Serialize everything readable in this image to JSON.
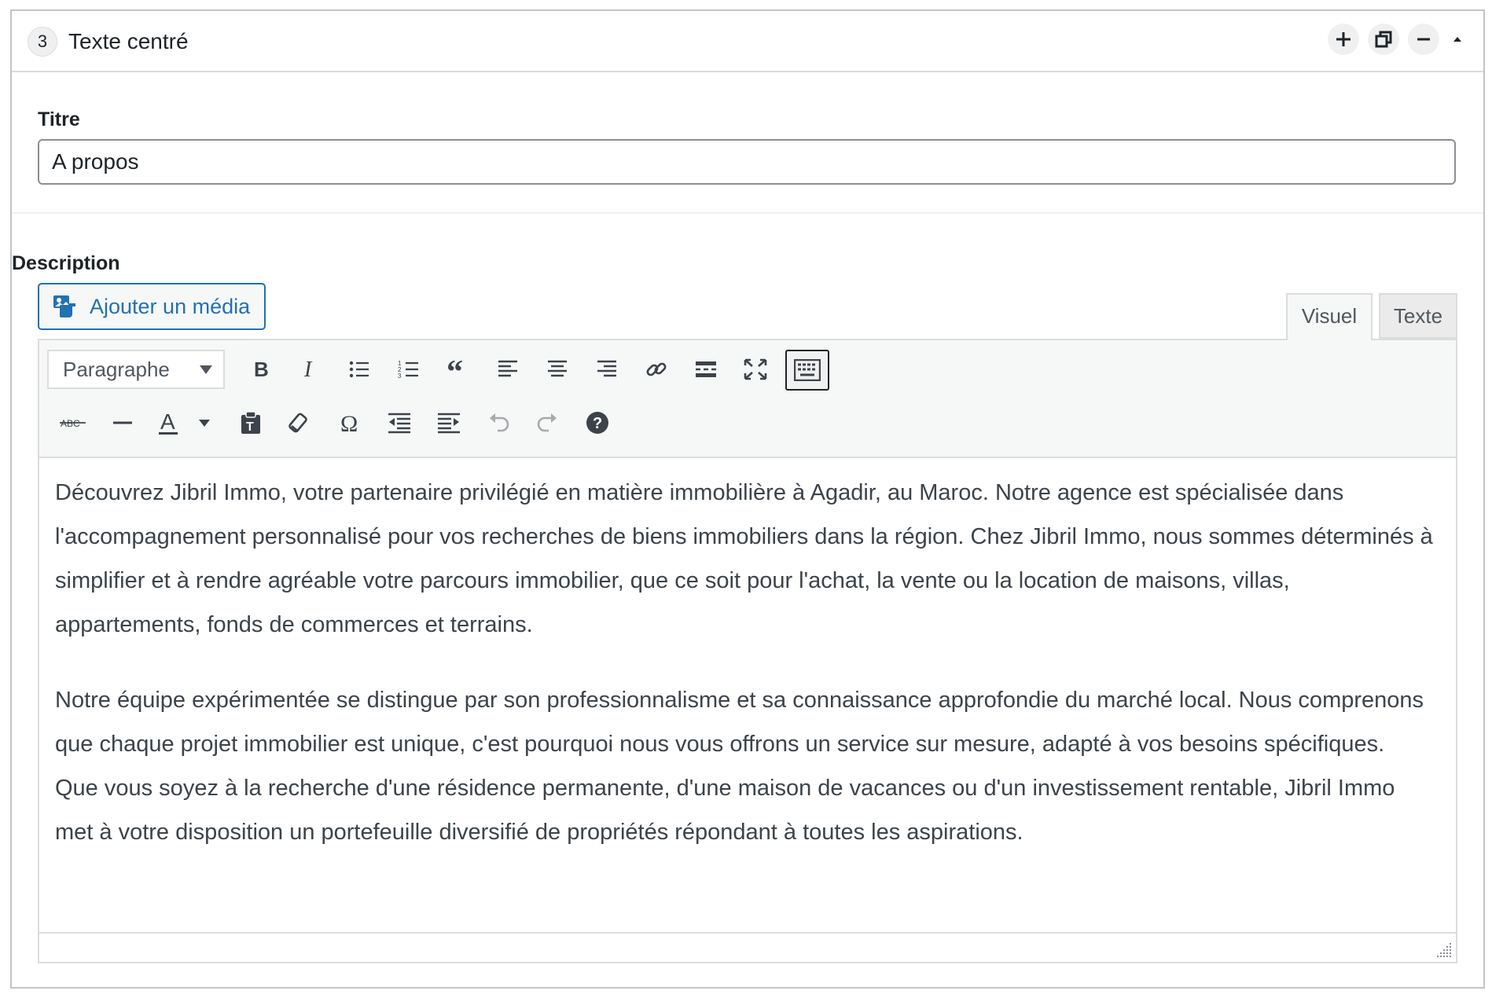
{
  "widget": {
    "number": "3",
    "title": "Texte centré",
    "action_icons": [
      "plus-icon",
      "duplicate-icon",
      "minus-icon",
      "collapse-arrow-icon"
    ]
  },
  "titre": {
    "label": "Titre",
    "value": "A propos"
  },
  "description": {
    "label": "Description",
    "add_media_label": "Ajouter un média",
    "tabs": {
      "visual": "Visuel",
      "text": "Texte",
      "active": "Visuel"
    },
    "format_select": "Paragraphe",
    "toolbar_row1_icons": [
      "bold-icon",
      "italic-icon",
      "bullet-list-icon",
      "numbered-list-icon",
      "blockquote-icon",
      "align-left-icon",
      "align-center-icon",
      "align-right-icon",
      "link-icon",
      "read-more-icon",
      "fullscreen-icon",
      "toolbar-toggle-icon"
    ],
    "toolbar_row2_icons": [
      "strikethrough-icon",
      "horizontal-line-icon",
      "text-color-icon",
      "paste-text-icon",
      "clear-formatting-icon",
      "special-character-icon",
      "outdent-icon",
      "indent-icon",
      "undo-icon",
      "redo-icon",
      "help-icon"
    ],
    "paragraphs": [
      "Découvrez Jibril Immo, votre partenaire privilégié en matière immobilière à Agadir, au Maroc. Notre agence est spécialisée dans l'accompagnement personnalisé pour vos recherches de biens immobiliers dans la région. Chez Jibril Immo, nous sommes déterminés à simplifier et à rendre agréable votre parcours immobilier, que ce soit pour l'achat, la vente ou la location de maisons, villas, appartements, fonds de commerces et terrains.",
      "Notre équipe expérimentée se distingue par son professionnalisme et sa connaissance approfondie du marché local. Nous comprenons que chaque projet immobilier est unique, c'est pourquoi nous vous offrons un service sur mesure, adapté à vos besoins spécifiques. Que vous soyez à la recherche d'une résidence permanente, d'une maison de vacances ou d'un investissement rentable, Jibril Immo met à votre disposition un portefeuille diversifié de propriétés répondant à toutes les aspirations."
    ]
  },
  "colors": {
    "accent": "#2271b1",
    "border": "#dcdcde",
    "text": "#3c434a"
  }
}
